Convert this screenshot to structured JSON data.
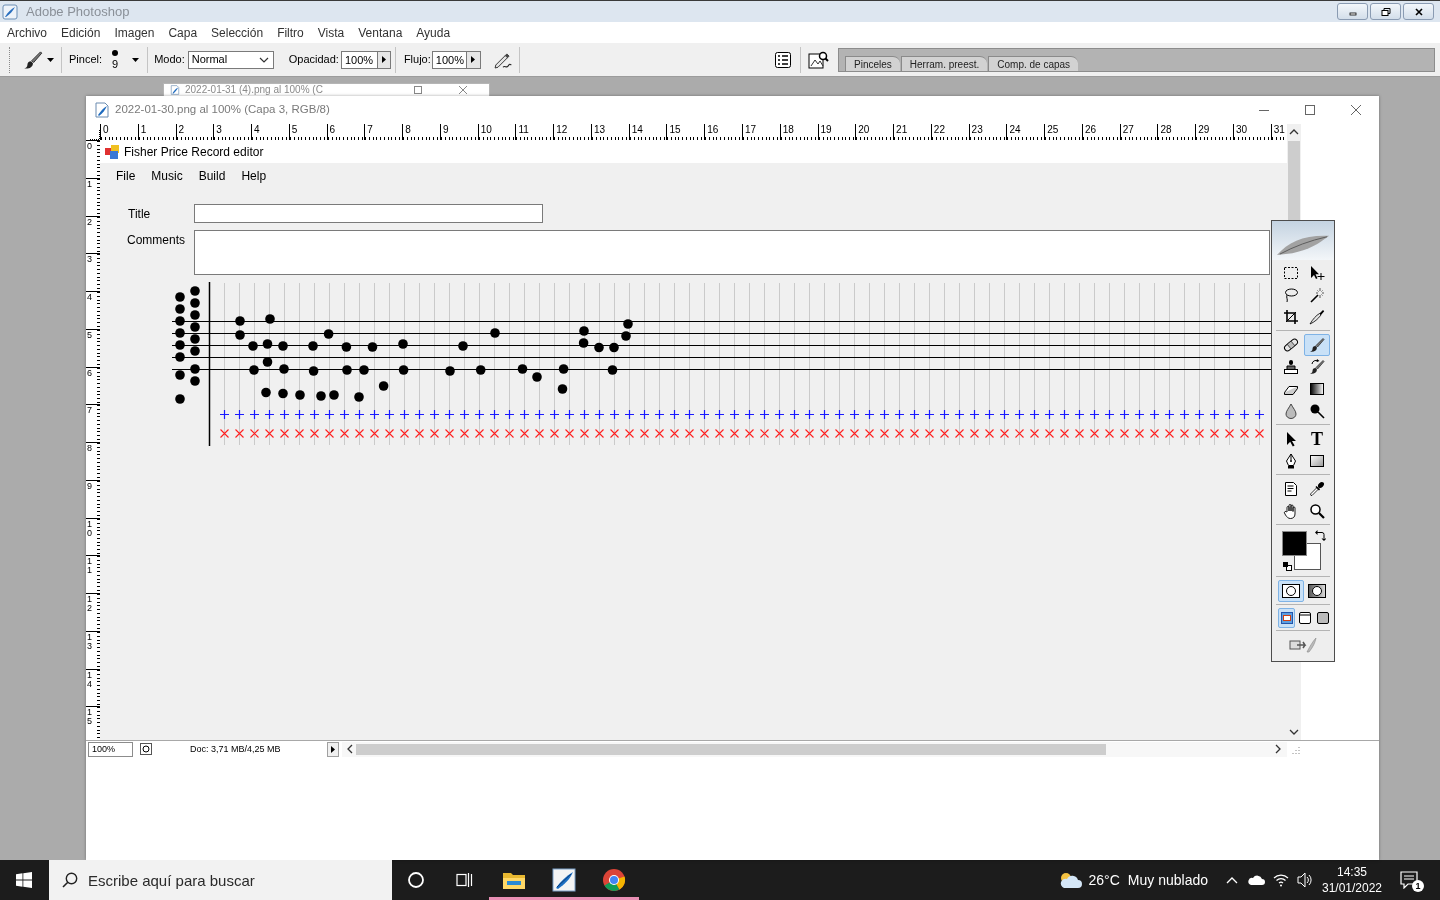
{
  "app_window": {
    "title": "Adobe Photoshop"
  },
  "menu_bar": [
    "Archivo",
    "Edición",
    "Imagen",
    "Capa",
    "Selección",
    "Filtro",
    "Vista",
    "Ventana",
    "Ayuda"
  ],
  "options_bar": {
    "brush_label": "Pincel:",
    "brush_size": "9",
    "mode_label": "Modo:",
    "mode": "Normal",
    "opacity_label": "Opacidad:",
    "opacity": "100%",
    "flow_label": "Flujo:",
    "flow": "100%"
  },
  "palette_well": {
    "tabs": [
      "Pinceles",
      "Herram. preest.",
      "Comp. de capas"
    ]
  },
  "background_document": {
    "title": "2022-01-31 (4).png al 100% (C"
  },
  "document": {
    "title": "2022-01-30.png al 100% (Capa 3, RGB/8)",
    "ruler_horizontal": [
      "0",
      "1",
      "2",
      "3",
      "4",
      "5",
      "6",
      "7",
      "8",
      "9",
      "10",
      "11",
      "12",
      "13",
      "14",
      "15",
      "16",
      "17",
      "18",
      "19",
      "20",
      "21",
      "22",
      "23",
      "24",
      "25",
      "26",
      "27",
      "28",
      "29",
      "30",
      "31"
    ],
    "ruler_vertical": [
      "0",
      "1",
      "2",
      "3",
      "4",
      "5",
      "6",
      "7",
      "8",
      "9",
      "10",
      "11",
      "12",
      "13",
      "14",
      "15"
    ],
    "canvas": {
      "app_title": "Fisher Price Record editor",
      "menu": [
        "File",
        "Music",
        "Build",
        "Help"
      ],
      "fields": [
        {
          "kind": "line",
          "label": "Title"
        },
        {
          "kind": "box",
          "label": "Comments"
        }
      ]
    },
    "status_bar": {
      "zoom": "100%",
      "doc_info": "Doc: 3,71 MB/4,25 MB"
    }
  },
  "toolbox": {
    "groups": [
      [
        {
          "kind": "marquee",
          "selected": false
        },
        {
          "kind": "move",
          "selected": false
        },
        {
          "kind": "lasso",
          "selected": false
        },
        {
          "kind": "magic-wand",
          "selected": false
        },
        {
          "kind": "crop",
          "selected": false
        },
        {
          "kind": "slice",
          "selected": false
        }
      ],
      [
        {
          "kind": "healing-brush",
          "selected": false
        },
        {
          "kind": "brush",
          "selected": true
        },
        {
          "kind": "clone-stamp",
          "selected": false
        },
        {
          "kind": "history-brush",
          "selected": false
        },
        {
          "kind": "eraser",
          "selected": false
        },
        {
          "kind": "gradient",
          "selected": false
        },
        {
          "kind": "blur",
          "selected": false
        },
        {
          "kind": "dodge",
          "selected": false
        }
      ],
      [
        {
          "kind": "path-selection",
          "selected": false
        },
        {
          "kind": "type",
          "glyph": "T",
          "selected": false
        },
        {
          "kind": "pen",
          "selected": false
        },
        {
          "kind": "shape",
          "selected": false
        }
      ],
      [
        {
          "kind": "notes",
          "selected": false
        },
        {
          "kind": "eyedropper",
          "selected": false
        },
        {
          "kind": "hand",
          "selected": false
        },
        {
          "kind": "zoom",
          "selected": false
        }
      ]
    ],
    "foreground": {
      "color": "#000000"
    },
    "background": {
      "color": "#ffffff"
    },
    "mask_modes": [
      {
        "kind": "standard",
        "selected": true
      },
      {
        "kind": "quick-mask",
        "selected": false
      }
    ],
    "screen_modes": [
      {
        "kind": "window",
        "selected": true
      },
      {
        "kind": "full-menu",
        "selected": false
      },
      {
        "kind": "full",
        "selected": false
      }
    ]
  },
  "taskbar": {
    "search_placeholder": "Escribe aquí para buscar",
    "apps": [
      {
        "kind": "explorer",
        "running": true
      },
      {
        "kind": "photoshop",
        "running": true
      },
      {
        "kind": "browser",
        "running": true
      }
    ],
    "weather": {
      "temperature": "26°C",
      "condition": "Muy nublado"
    },
    "time": "14:35",
    "date": "31/01/2022",
    "notification_count": "1"
  }
}
